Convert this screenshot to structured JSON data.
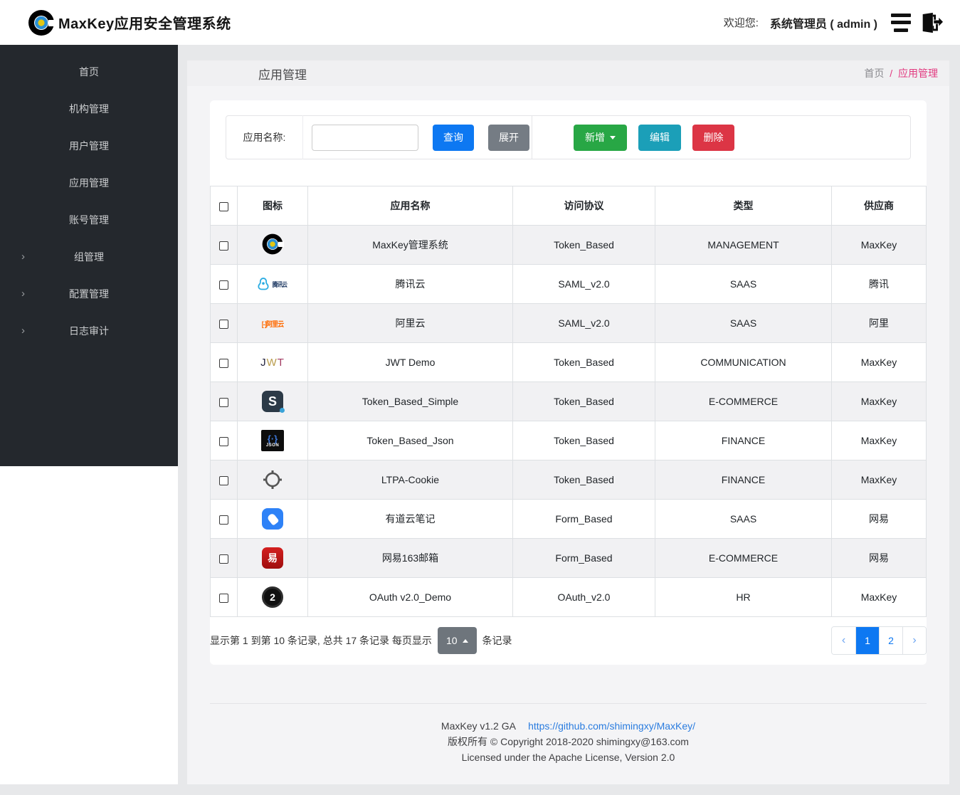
{
  "header": {
    "title": "MaxKey应用安全管理系统",
    "welcome_label": "欢迎您:",
    "user": "系统管理员 ( admin )",
    "icons": {
      "brand": "maxkey-target-logo",
      "menu": "menu-lines-icon",
      "logout": "door-exit-arrow-icon"
    }
  },
  "sidebar": {
    "items": [
      {
        "label": "首页",
        "expandable": false
      },
      {
        "label": "机构管理",
        "expandable": false
      },
      {
        "label": "用户管理",
        "expandable": false
      },
      {
        "label": "应用管理",
        "expandable": false
      },
      {
        "label": "账号管理",
        "expandable": false
      },
      {
        "label": "组管理",
        "expandable": true
      },
      {
        "label": "配置管理",
        "expandable": true
      },
      {
        "label": "日志审计",
        "expandable": true
      }
    ],
    "caret": "›"
  },
  "page": {
    "title": "应用管理",
    "breadcrumb": {
      "home": "首页",
      "separator": "/",
      "current": "应用管理"
    }
  },
  "toolbar": {
    "search_label": "应用名称:",
    "search_value": "",
    "query_label": "查询",
    "expand_label": "展开",
    "add_label": "新增",
    "edit_label": "编辑",
    "delete_label": "删除"
  },
  "table": {
    "columns": [
      "图标",
      "应用名称",
      "访问协议",
      "类型",
      "供应商"
    ],
    "rows": [
      {
        "icon": "maxkey-logo",
        "name": "MaxKey管理系统",
        "protocol": "Token_Based",
        "type": "MANAGEMENT",
        "vendor": "MaxKey"
      },
      {
        "icon": "tencent-cloud-logo",
        "icon_text": "腾讯云",
        "name": "腾讯云",
        "protocol": "SAML_v2.0",
        "type": "SAAS",
        "vendor": "腾讯"
      },
      {
        "icon": "aliyun-logo",
        "icon_text": "[-]阿里云",
        "name": "阿里云",
        "protocol": "SAML_v2.0",
        "type": "SAAS",
        "vendor": "阿里"
      },
      {
        "icon": "jwt-logo",
        "icon_letters": [
          "J",
          "W",
          "T"
        ],
        "name": "JWT Demo",
        "protocol": "Token_Based",
        "type": "COMMUNICATION",
        "vendor": "MaxKey"
      },
      {
        "icon": "s-letter-logo",
        "icon_text": "S",
        "name": "Token_Based_Simple",
        "protocol": "Token_Based",
        "type": "E-COMMERCE",
        "vendor": "MaxKey"
      },
      {
        "icon": "json-logo",
        "icon_sym": "{·}",
        "icon_text": "JSON",
        "name": "Token_Based_Json",
        "protocol": "Token_Based",
        "type": "FINANCE",
        "vendor": "MaxKey"
      },
      {
        "icon": "ltpa-target-logo",
        "name": "LTPA-Cookie",
        "protocol": "Token_Based",
        "type": "FINANCE",
        "vendor": "MaxKey"
      },
      {
        "icon": "youdao-note-logo",
        "name": "有道云笔记",
        "protocol": "Form_Based",
        "type": "SAAS",
        "vendor": "网易"
      },
      {
        "icon": "netease-163-logo",
        "icon_text": "易",
        "name": "网易163邮箱",
        "protocol": "Form_Based",
        "type": "E-COMMERCE",
        "vendor": "网易"
      },
      {
        "icon": "oauth2-logo",
        "icon_text": "2",
        "name": "OAuth v2.0_Demo",
        "protocol": "OAuth_v2.0",
        "type": "HR",
        "vendor": "MaxKey"
      }
    ]
  },
  "pagination": {
    "summary_prefix": "显示第 1 到第 10 条记录, 总共 17 条记录  每页显示",
    "page_size": "10",
    "summary_suffix": "条记录",
    "prev": "‹",
    "next": "›",
    "pages": [
      "1",
      "2"
    ],
    "active_page": "1"
  },
  "footer": {
    "version": "MaxKey  v1.2 GA",
    "link": "https://github.com/shimingxy/MaxKey/",
    "copyright": "版权所有 © Copyright 2018-2020 shimingxy@163.com",
    "license": "Licensed under the Apache License, Version 2.0"
  },
  "colors": {
    "primary_blue": "#0d78f2",
    "green": "#28a745",
    "teal": "#1b9fb8",
    "red": "#dc3545",
    "gray_button": "#6e757c",
    "breadcrumb_pink": "#e23a80",
    "sidebar_bg": "#24282d",
    "row_stripe": "#f1f1f3"
  }
}
